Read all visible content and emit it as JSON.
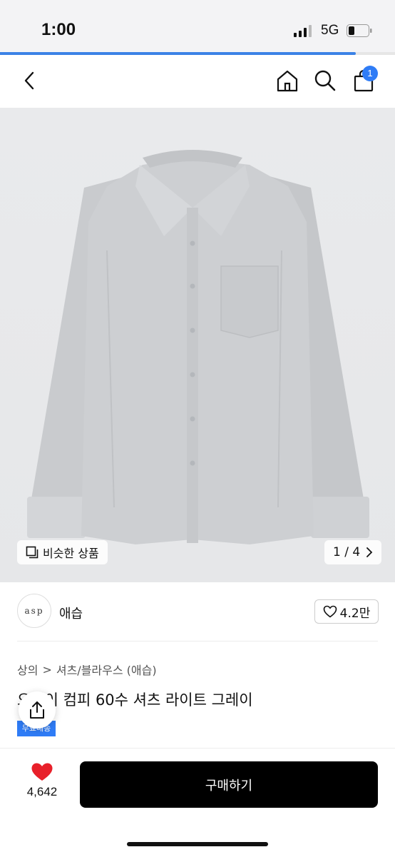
{
  "status_bar": {
    "time": "1:00",
    "network": "5G"
  },
  "page_load_progress": 0.9,
  "nav": {
    "cart_count": "1"
  },
  "product_image": {
    "similar_label": "비슷한 상품",
    "page_current": "1",
    "page_total": "4",
    "page_separator": "/"
  },
  "brand": {
    "logo_text": "asp",
    "name": "애습",
    "likes": "4.2만"
  },
  "breadcrumb": {
    "category": "상의",
    "separator": ">",
    "subcategory": "셔츠/블라우스 (애습)"
  },
  "product": {
    "title": "오버이 컴피 60수 셔츠 라이트 그레이",
    "tag": "무료배송"
  },
  "bottom_bar": {
    "like_count": "4,642",
    "buy_label": "구매하기"
  },
  "colors": {
    "accent": "#2f7cf6",
    "heart": "#e8202a",
    "buy_button": "#000000"
  }
}
